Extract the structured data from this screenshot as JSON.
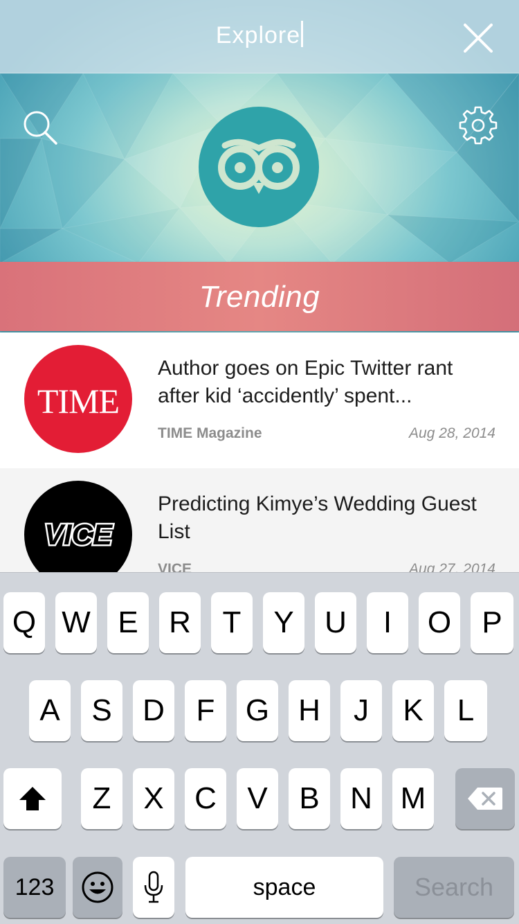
{
  "search": {
    "value": "Explore"
  },
  "header": {
    "close_icon": "close-icon",
    "search_icon": "search-icon",
    "settings_icon": "gear-icon",
    "logo_icon": "owl-logo-icon",
    "section_title": "Trending"
  },
  "feed": {
    "items": [
      {
        "title": "Author goes on Epic Twitter rant after kid ‘accidently’ spent...",
        "source": "TIME Magazine",
        "date": "Aug 28, 2014",
        "logo_text": "TIME",
        "logo_color": "#e31d35"
      },
      {
        "title": "Predicting Kimye’s Wedding Guest List",
        "source": "VICE",
        "date": "Aug 27, 2014",
        "logo_text": "VICE",
        "logo_color": "#000000"
      }
    ]
  },
  "keyboard": {
    "row1": [
      "Q",
      "W",
      "E",
      "R",
      "T",
      "Y",
      "U",
      "I",
      "O",
      "P"
    ],
    "row2": [
      "A",
      "S",
      "D",
      "F",
      "G",
      "H",
      "J",
      "K",
      "L"
    ],
    "row3": [
      "Z",
      "X",
      "C",
      "V",
      "B",
      "N",
      "M"
    ],
    "numbers_label": "123",
    "space_label": "space",
    "search_label": "Search",
    "shift_icon": "shift-icon",
    "delete_icon": "backspace-icon",
    "emoji_icon": "emoji-icon",
    "mic_icon": "microphone-icon"
  },
  "colors": {
    "trending_bar": "#e58784",
    "header_teal": "#4ea6b9",
    "logo_teal": "#2fa3a9",
    "keyboard_bg": "#d1d5db"
  }
}
